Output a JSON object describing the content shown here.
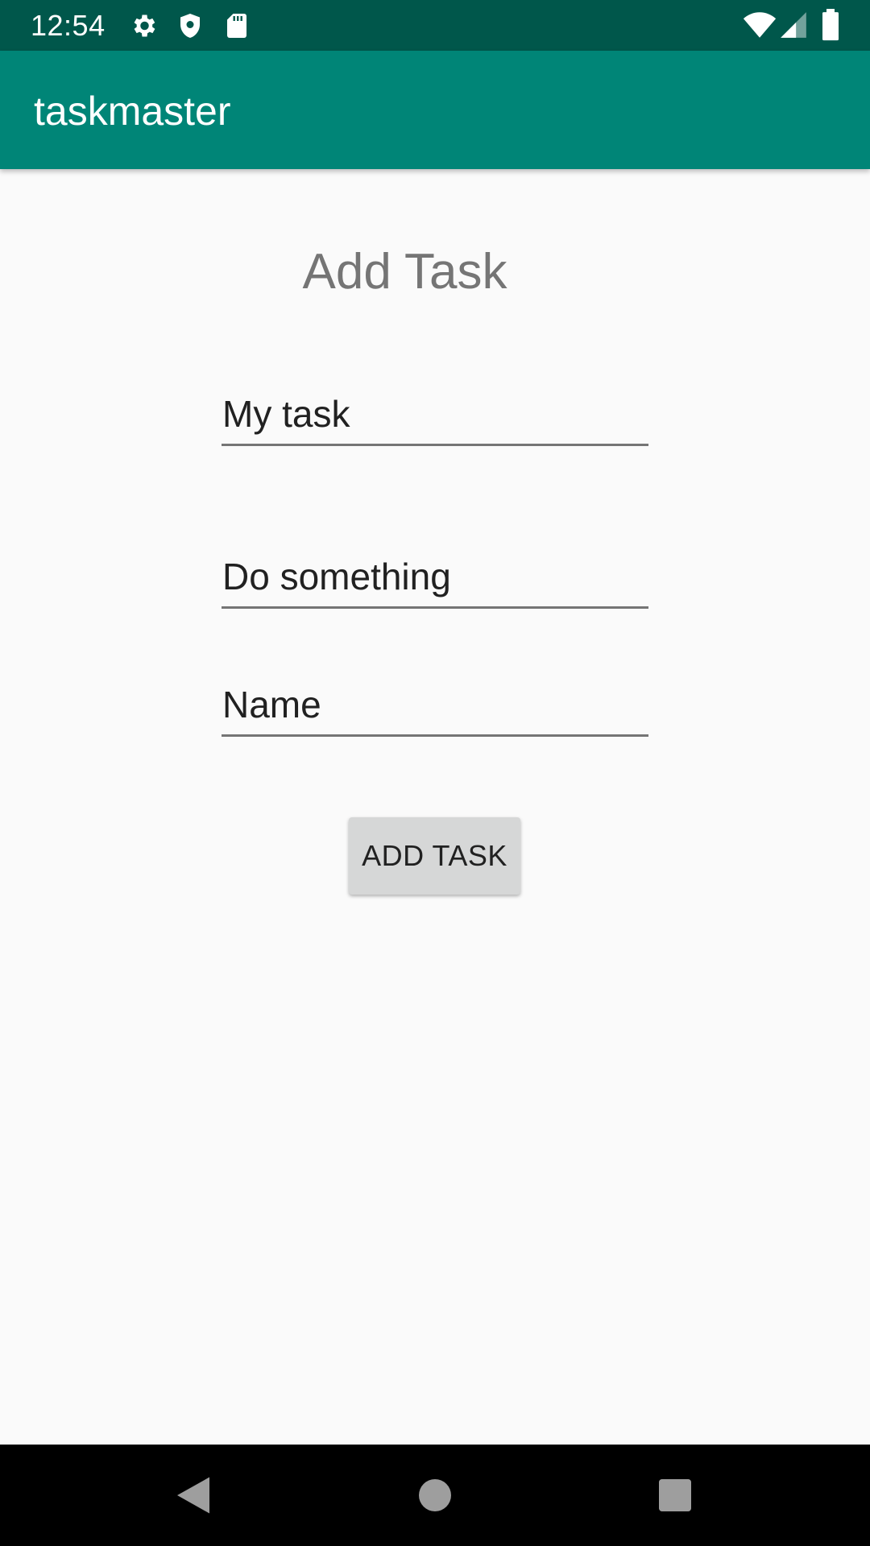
{
  "status_bar": {
    "time": "12:54",
    "left_icons": [
      "gear-icon",
      "shield-icon",
      "sd-card-icon"
    ],
    "right_icons": [
      "wifi-icon",
      "cell-signal-icon",
      "battery-icon"
    ],
    "background_color": "#00574b"
  },
  "app_bar": {
    "title": "taskmaster",
    "background_color": "#008577"
  },
  "form": {
    "heading": "Add Task",
    "task_title_value": "My task",
    "task_body_value": "Do something",
    "name_value": "Name",
    "submit_label": "ADD TASK"
  },
  "nav_bar": {
    "buttons": [
      "back-icon",
      "home-icon",
      "recents-icon"
    ]
  }
}
